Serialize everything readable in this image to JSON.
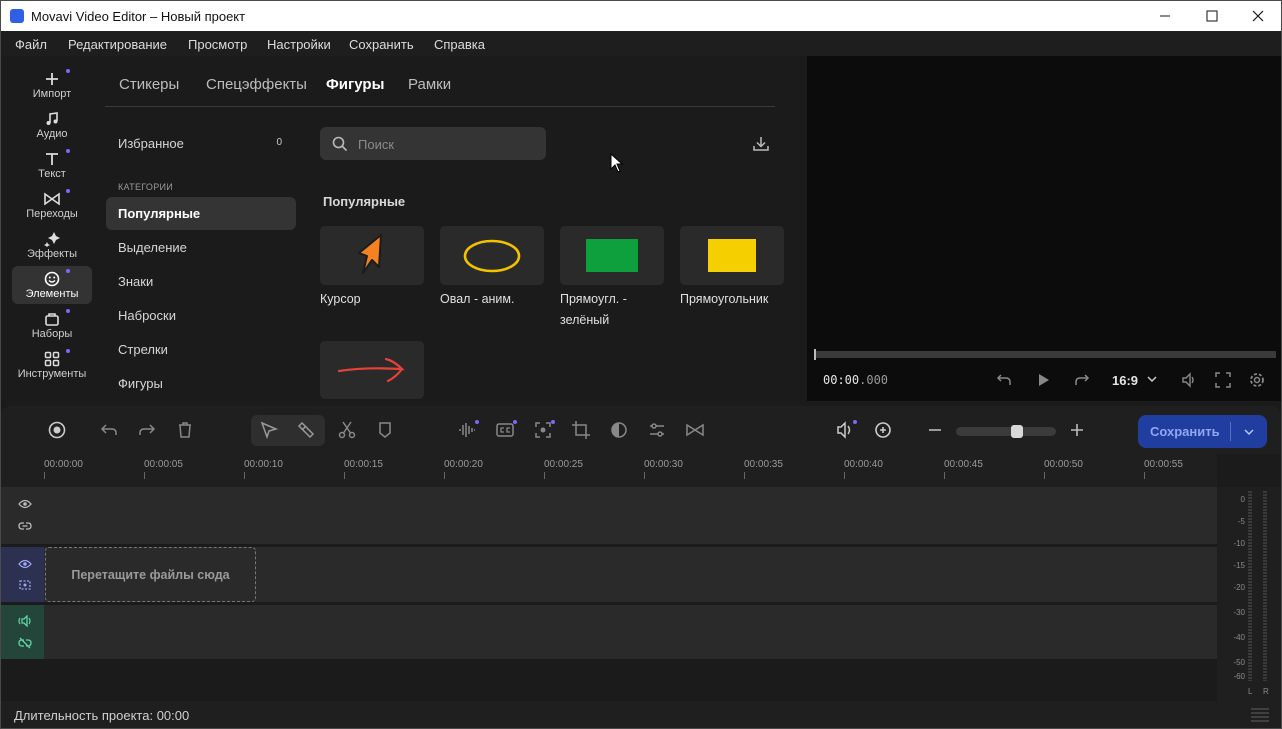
{
  "window": {
    "title": "Movavi Video Editor – Новый проект"
  },
  "menu": [
    "Файл",
    "Редактирование",
    "Просмотр",
    "Настройки",
    "Сохранить",
    "Справка"
  ],
  "rail": [
    {
      "label": "Импорт",
      "icon": "plus-icon"
    },
    {
      "label": "Аудио",
      "icon": "music-note-icon"
    },
    {
      "label": "Текст",
      "icon": "text-icon"
    },
    {
      "label": "Переходы",
      "icon": "transition-icon"
    },
    {
      "label": "Эффекты",
      "icon": "sparkle-icon"
    },
    {
      "label": "Элементы",
      "icon": "smiley-icon"
    },
    {
      "label": "Наборы",
      "icon": "bag-icon"
    },
    {
      "label": "Инструменты",
      "icon": "grid-icon"
    }
  ],
  "tabs": [
    "Стикеры",
    "Спецэффекты",
    "Фигуры",
    "Рамки"
  ],
  "favorites": {
    "label": "Избранное",
    "count": "0"
  },
  "categories_header": "КАТЕГОРИИ",
  "categories": [
    "Популярные",
    "Выделение",
    "Знаки",
    "Наброски",
    "Стрелки",
    "Фигуры"
  ],
  "search": {
    "placeholder": "Поиск"
  },
  "section_title": "Популярные",
  "items": [
    {
      "label": "Курсор"
    },
    {
      "label": "Овал - аним."
    },
    {
      "label": "Прямоугл. - зелёный"
    },
    {
      "label": "Прямоугольник"
    }
  ],
  "preview": {
    "timecode_main": "00:00",
    "timecode_frac": ".000",
    "aspect": "16:9"
  },
  "toolbar": {
    "save_label": "Сохранить"
  },
  "ruler": [
    "00:00:00",
    "00:00:05",
    "00:00:10",
    "00:00:15",
    "00:00:20",
    "00:00:25",
    "00:00:30",
    "00:00:35",
    "00:00:40",
    "00:00:45",
    "00:00:50",
    "00:00:55"
  ],
  "timeline": {
    "drop_hint": "Перетащите файлы сюда"
  },
  "meter": {
    "labels": [
      "0",
      "-5",
      "-10",
      "-15",
      "-20",
      "-30",
      "-40",
      "-50",
      "-60"
    ],
    "channels": [
      "L",
      "R"
    ]
  },
  "status": {
    "duration": "Длительность проекта: 00:00"
  },
  "colors": {
    "accent": "#2f5fe8",
    "dot": "#7b68ff",
    "save_button": "#1f3ea0",
    "track_video": "#2c3152",
    "track_audio": "#24463a"
  }
}
